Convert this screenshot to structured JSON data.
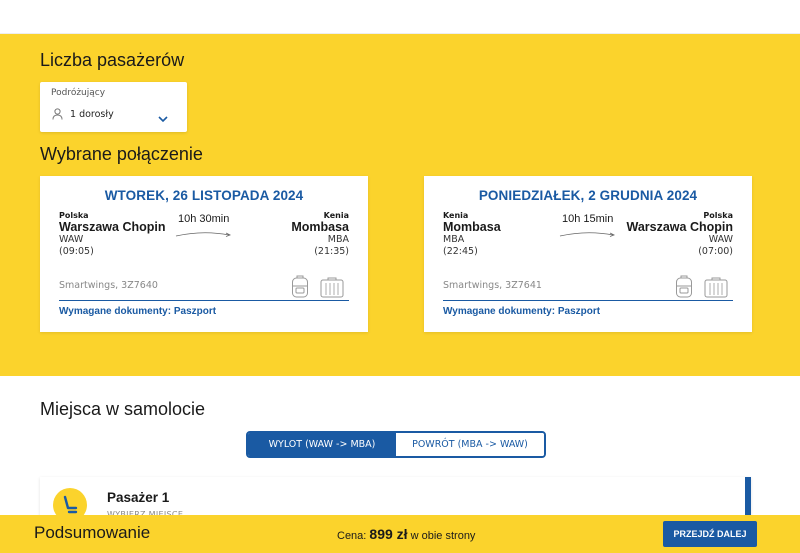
{
  "passengers": {
    "heading": "Liczba pasażerów",
    "field_label": "Podróżujący",
    "field_value": "1 dorosły"
  },
  "connection": {
    "heading": "Wybrane połączenie",
    "flights": [
      {
        "date": "WTOREK, 26 LISTOPADA 2024",
        "origin": {
          "country": "Polska",
          "airport": "Warszawa Chopin",
          "code": "WAW",
          "time": "(09:05)"
        },
        "destination": {
          "country": "Kenia",
          "airport": "Mombasa",
          "code": "MBA",
          "time": "(21:35)"
        },
        "duration": "10h 30min",
        "carrier": "Smartwings, 3Z7640",
        "documents": "Wymagane dokumenty: Paszport"
      },
      {
        "date": "PONIEDZIAŁEK, 2 GRUDNIA 2024",
        "origin": {
          "country": "Kenia",
          "airport": "Mombasa",
          "code": "MBA",
          "time": "(22:45)"
        },
        "destination": {
          "country": "Polska",
          "airport": "Warszawa Chopin",
          "code": "WAW",
          "time": "(07:00)"
        },
        "duration": "10h 15min",
        "carrier": "Smartwings, 3Z7641",
        "documents": "Wymagane dokumenty: Paszport"
      }
    ]
  },
  "seats": {
    "heading": "Miejsca w samolocie",
    "tabs": [
      {
        "label": "WYLOT (WAW -> MBA)",
        "active": true
      },
      {
        "label": "POWRÓT (MBA -> WAW)",
        "active": false
      }
    ],
    "passenger": {
      "name": "Pasażer 1",
      "action": "WYBIERZ MIEJSCE"
    }
  },
  "footer": {
    "summary": "Podsumowanie",
    "price_prefix": "Cena:",
    "price_amount": "899 zł",
    "price_suffix": "w obie strony",
    "next_button": "PRZEJDŹ DALEJ"
  },
  "colors": {
    "accent": "#1a5aa3",
    "brand_yellow": "#fbd32c"
  },
  "icons": [
    "person-icon",
    "chevron-down-icon",
    "flight-route-icon",
    "backpack-icon",
    "suitcase-icon",
    "seat-icon"
  ]
}
